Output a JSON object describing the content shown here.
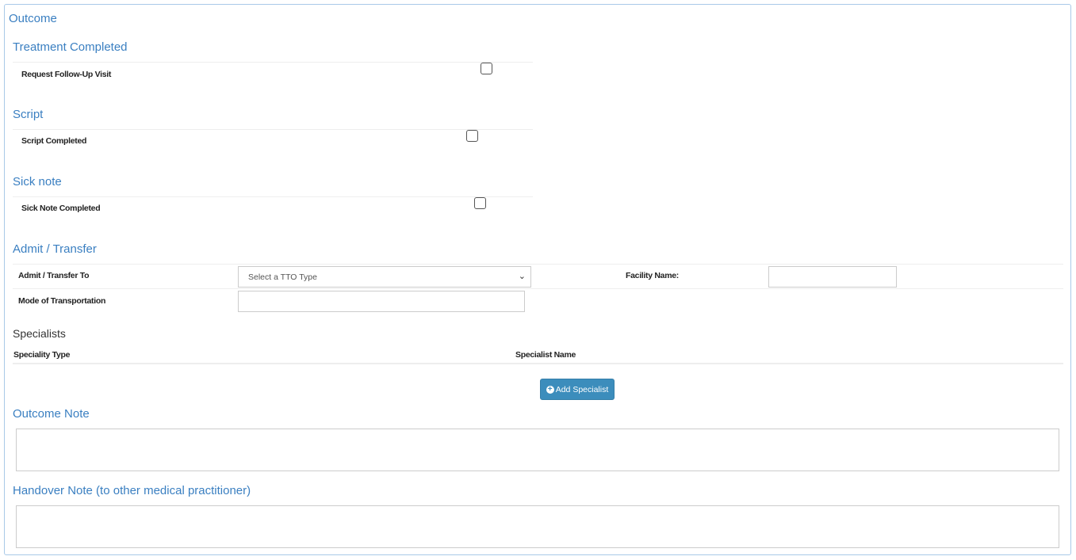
{
  "title": "Outcome",
  "treatment": {
    "heading": "Treatment Completed",
    "label": "Request Follow-Up Visit",
    "checked": false
  },
  "script": {
    "heading": "Script",
    "label": "Script Completed",
    "checked": false
  },
  "sick_note": {
    "heading": "Sick note",
    "label": "Sick Note Completed",
    "checked": false
  },
  "admit": {
    "heading": "Admit / Transfer",
    "to_label": "Admit / Transfer To",
    "to_value": "Select a TTO Type",
    "facility_label": "Facility Name:",
    "facility_value": "",
    "transport_label": "Mode of Transportation",
    "transport_value": ""
  },
  "specialists": {
    "heading": "Specialists",
    "col_type": "Speciality Type",
    "col_name": "Specialist Name",
    "add_button": "Add Specialist"
  },
  "outcome_note": {
    "heading": "Outcome Note",
    "value": ""
  },
  "handover_note": {
    "heading": "Handover Note (to other medical practitioner)",
    "value": ""
  }
}
